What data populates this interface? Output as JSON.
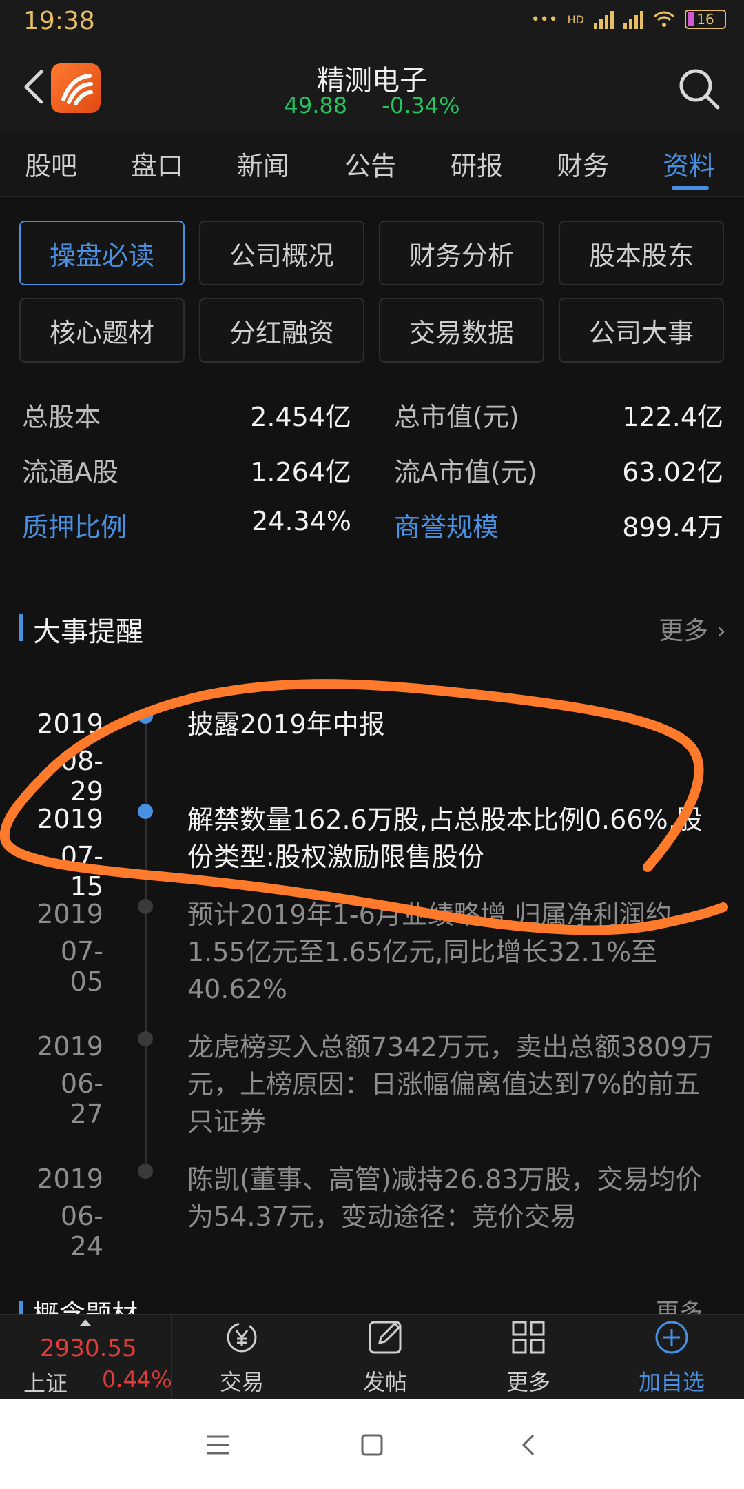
{
  "status": {
    "time": "19:38",
    "net": "HD",
    "battery": "16"
  },
  "header": {
    "name": "精测电子",
    "price": "49.88",
    "change": "-0.34%"
  },
  "tabs": [
    {
      "label": "股吧"
    },
    {
      "label": "盘口"
    },
    {
      "label": "新闻"
    },
    {
      "label": "公告"
    },
    {
      "label": "研报"
    },
    {
      "label": "财务"
    },
    {
      "label": "资料"
    }
  ],
  "grid": [
    {
      "label": "操盘必读"
    },
    {
      "label": "公司概况"
    },
    {
      "label": "财务分析"
    },
    {
      "label": "股本股东"
    },
    {
      "label": "核心题材"
    },
    {
      "label": "分红融资"
    },
    {
      "label": "交易数据"
    },
    {
      "label": "公司大事"
    }
  ],
  "stats": [
    {
      "label": "总股本",
      "value": "2.454亿"
    },
    {
      "label": "总市值(元)",
      "value": "122.4亿"
    },
    {
      "label": "流通A股",
      "value": "1.264亿"
    },
    {
      "label": "流A市值(元)",
      "value": "63.02亿"
    },
    {
      "label": "质押比例",
      "value": "24.34%"
    },
    {
      "label": "商誉规模",
      "value": "899.4万"
    }
  ],
  "section": {
    "title": "大事提醒",
    "more": "更多"
  },
  "events": [
    {
      "year": "2019",
      "md": "08-29",
      "text": "披露2019年中报"
    },
    {
      "year": "2019",
      "md": "07-15",
      "text": "解禁数量162.6万股,占总股本比例0.66%,股份类型:股权激励限售股份"
    },
    {
      "year": "2019",
      "md": "07-05",
      "text": "预计2019年1-6月业绩略增,归属净利润约1.55亿元至1.65亿元,同比增长32.1%至40.62%"
    },
    {
      "year": "2019",
      "md": "06-27",
      "text": "龙虎榜买入总额7342万元，卖出总额3809万元，上榜原因：日涨幅偏离值达到7%的前五只证券"
    },
    {
      "year": "2019",
      "md": "06-24",
      "text": "陈凯(董事、高管)减持26.83万股，交易均价为54.37元，变动途径：竞价交易"
    }
  ],
  "next_section": {
    "title": "概念题材",
    "more": "更多"
  },
  "bottom": {
    "index_value": "2930.55",
    "index_name": "上证",
    "index_pct": "0.44%",
    "items": [
      {
        "label": "交易"
      },
      {
        "label": "发帖"
      },
      {
        "label": "更多"
      },
      {
        "label": "加自选"
      }
    ]
  },
  "colors": {
    "accent": "#4a90e2",
    "up": "#e03c3c",
    "down": "#22c55e",
    "annotation": "#ff7a2a"
  }
}
